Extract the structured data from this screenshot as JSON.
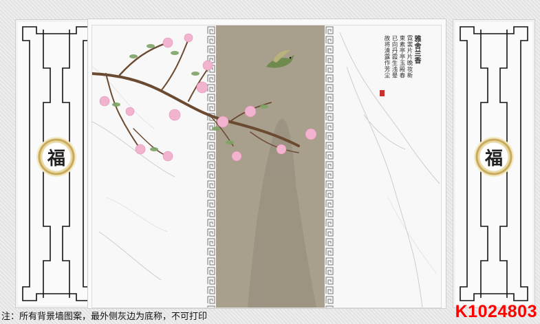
{
  "colors": {
    "panel_brown": "#a89f8c",
    "frame_line": "#111111",
    "code_red": "#ff0000",
    "blossom_pink": "#f2b3cf",
    "leaf_green": "#7fa466",
    "branch_brown": "#6b4a32"
  },
  "medal": {
    "glyph": "福"
  },
  "poem": {
    "title": "雅舍兰香",
    "lines": [
      "雅舍兰香",
      "霓裳片片晚妆新",
      "束素亭亭玉殿春",
      "已向丹霞生浅晕",
      "故将清露作芳尘"
    ]
  },
  "caption": "注：所有背景墙图案，最外侧灰边为底称，不可打印",
  "product_code": "K1024803",
  "icons": {
    "medal": "fu-character-medal-icon",
    "bird": "bird-icon",
    "seal": "red-seal-icon"
  }
}
